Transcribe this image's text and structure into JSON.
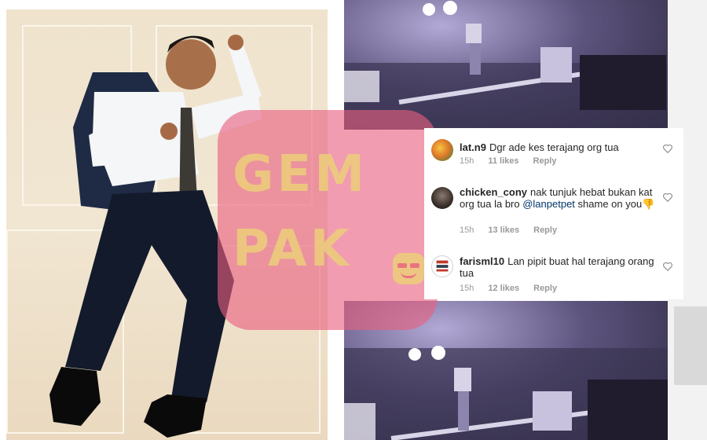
{
  "watermark": {
    "line1": "GEM",
    "line2": "PAK",
    "logo": "gempak-smiley-icon"
  },
  "photos": {
    "left": "man-jumping-photo",
    "cctv": "cctv-footage-still"
  },
  "comments": [
    {
      "username": "lat.n9",
      "text": "Dgr ade kes terajang org tua",
      "time": "15h",
      "likes": "11 likes",
      "reply": "Reply",
      "avatar_icon": "user-avatar-icon"
    },
    {
      "username": "chicken_cony",
      "text_before": "nak tunjuk hebat bukan kat org tua la bro ",
      "mention": "@lanpetpet",
      "text_after": "  shame on you",
      "emoji": "👎",
      "time": "15h",
      "likes": "13 likes",
      "reply": "Reply",
      "avatar_icon": "user-avatar-icon"
    },
    {
      "username": "farisml10",
      "text": "Lan pipit buat hal terajang orang tua",
      "time": "15h",
      "likes": "12 likes",
      "reply": "Reply",
      "avatar_icon": "user-avatar-icon"
    }
  ],
  "colors": {
    "watermark_pink": "#e85f80",
    "watermark_yellow": "#eccd7a",
    "mention_link": "#003569",
    "meta_gray": "#999999"
  }
}
